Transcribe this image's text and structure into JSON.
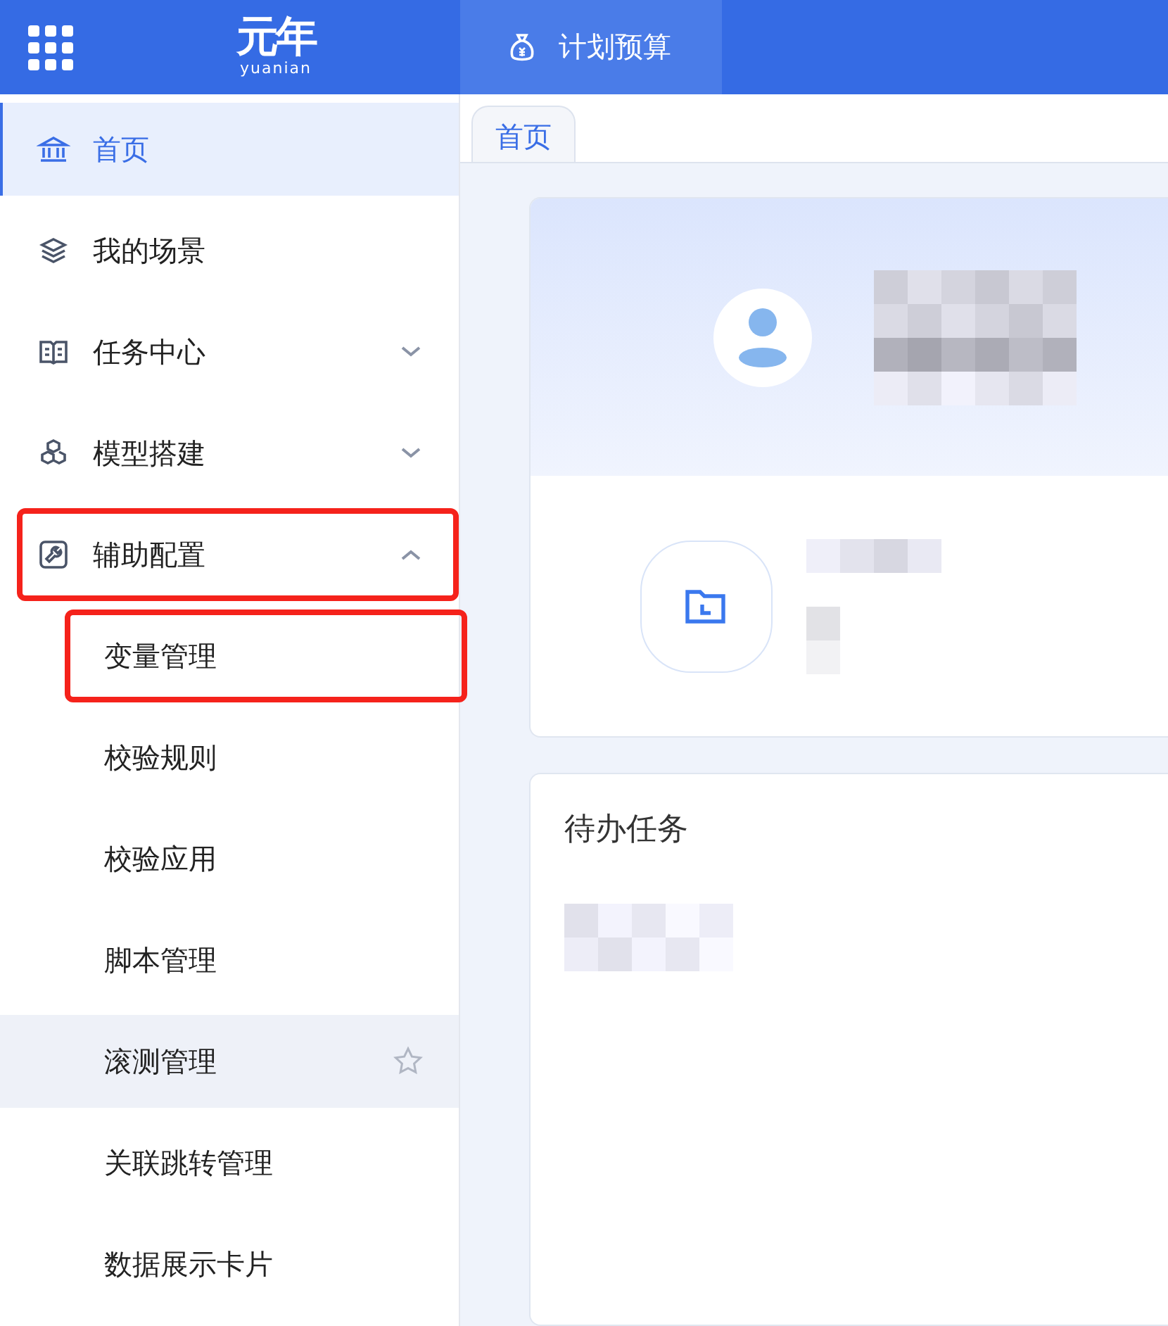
{
  "header": {
    "logo": {
      "mark": "元年",
      "word": "yuanian"
    },
    "app_tab": {
      "label": "计划预算",
      "selected": true
    }
  },
  "sidebar": {
    "items": [
      {
        "label": "首页",
        "selected": true,
        "highlighted": false
      },
      {
        "label": "我的场景",
        "selected": false,
        "highlighted": false
      },
      {
        "label": "任务中心",
        "selected": false,
        "highlighted": false,
        "expanded": false
      },
      {
        "label": "模型搭建",
        "selected": false,
        "highlighted": false,
        "expanded": false
      },
      {
        "label": "辅助配置",
        "selected": false,
        "highlighted": true,
        "expanded": true,
        "children": [
          {
            "label": "变量管理",
            "selected": false,
            "highlighted": true,
            "hovered": false
          },
          {
            "label": "校验规则",
            "selected": false,
            "highlighted": false,
            "hovered": false
          },
          {
            "label": "校验应用",
            "selected": false,
            "highlighted": false,
            "hovered": false
          },
          {
            "label": "脚本管理",
            "selected": false,
            "highlighted": false,
            "hovered": false
          },
          {
            "label": "滚测管理",
            "selected": false,
            "highlighted": false,
            "hovered": true
          },
          {
            "label": "关联跳转管理",
            "selected": false,
            "highlighted": false,
            "hovered": false
          },
          {
            "label": "数据展示卡片",
            "selected": false,
            "highlighted": false,
            "hovered": false
          }
        ]
      }
    ]
  },
  "page_tabs": [
    {
      "label": "首页",
      "selected": true
    }
  ],
  "todo_card": {
    "title": "待办任务"
  }
}
